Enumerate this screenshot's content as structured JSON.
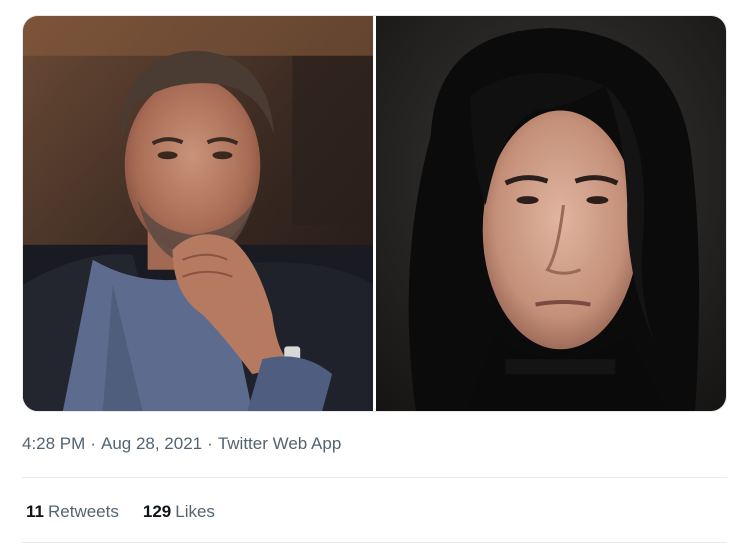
{
  "tweet": {
    "media": [
      {
        "alt": ""
      },
      {
        "alt": ""
      }
    ],
    "meta": {
      "time": "4:28 PM",
      "separator": "·",
      "date": "Aug 28, 2021",
      "source": "Twitter Web App"
    },
    "stats": {
      "retweets_count": "11",
      "retweets_label": "Retweets",
      "likes_count": "129",
      "likes_label": "Likes"
    }
  },
  "colors": {
    "secondary_text": "#536471",
    "primary_text": "#0f1419",
    "divider": "#e7ebee"
  }
}
